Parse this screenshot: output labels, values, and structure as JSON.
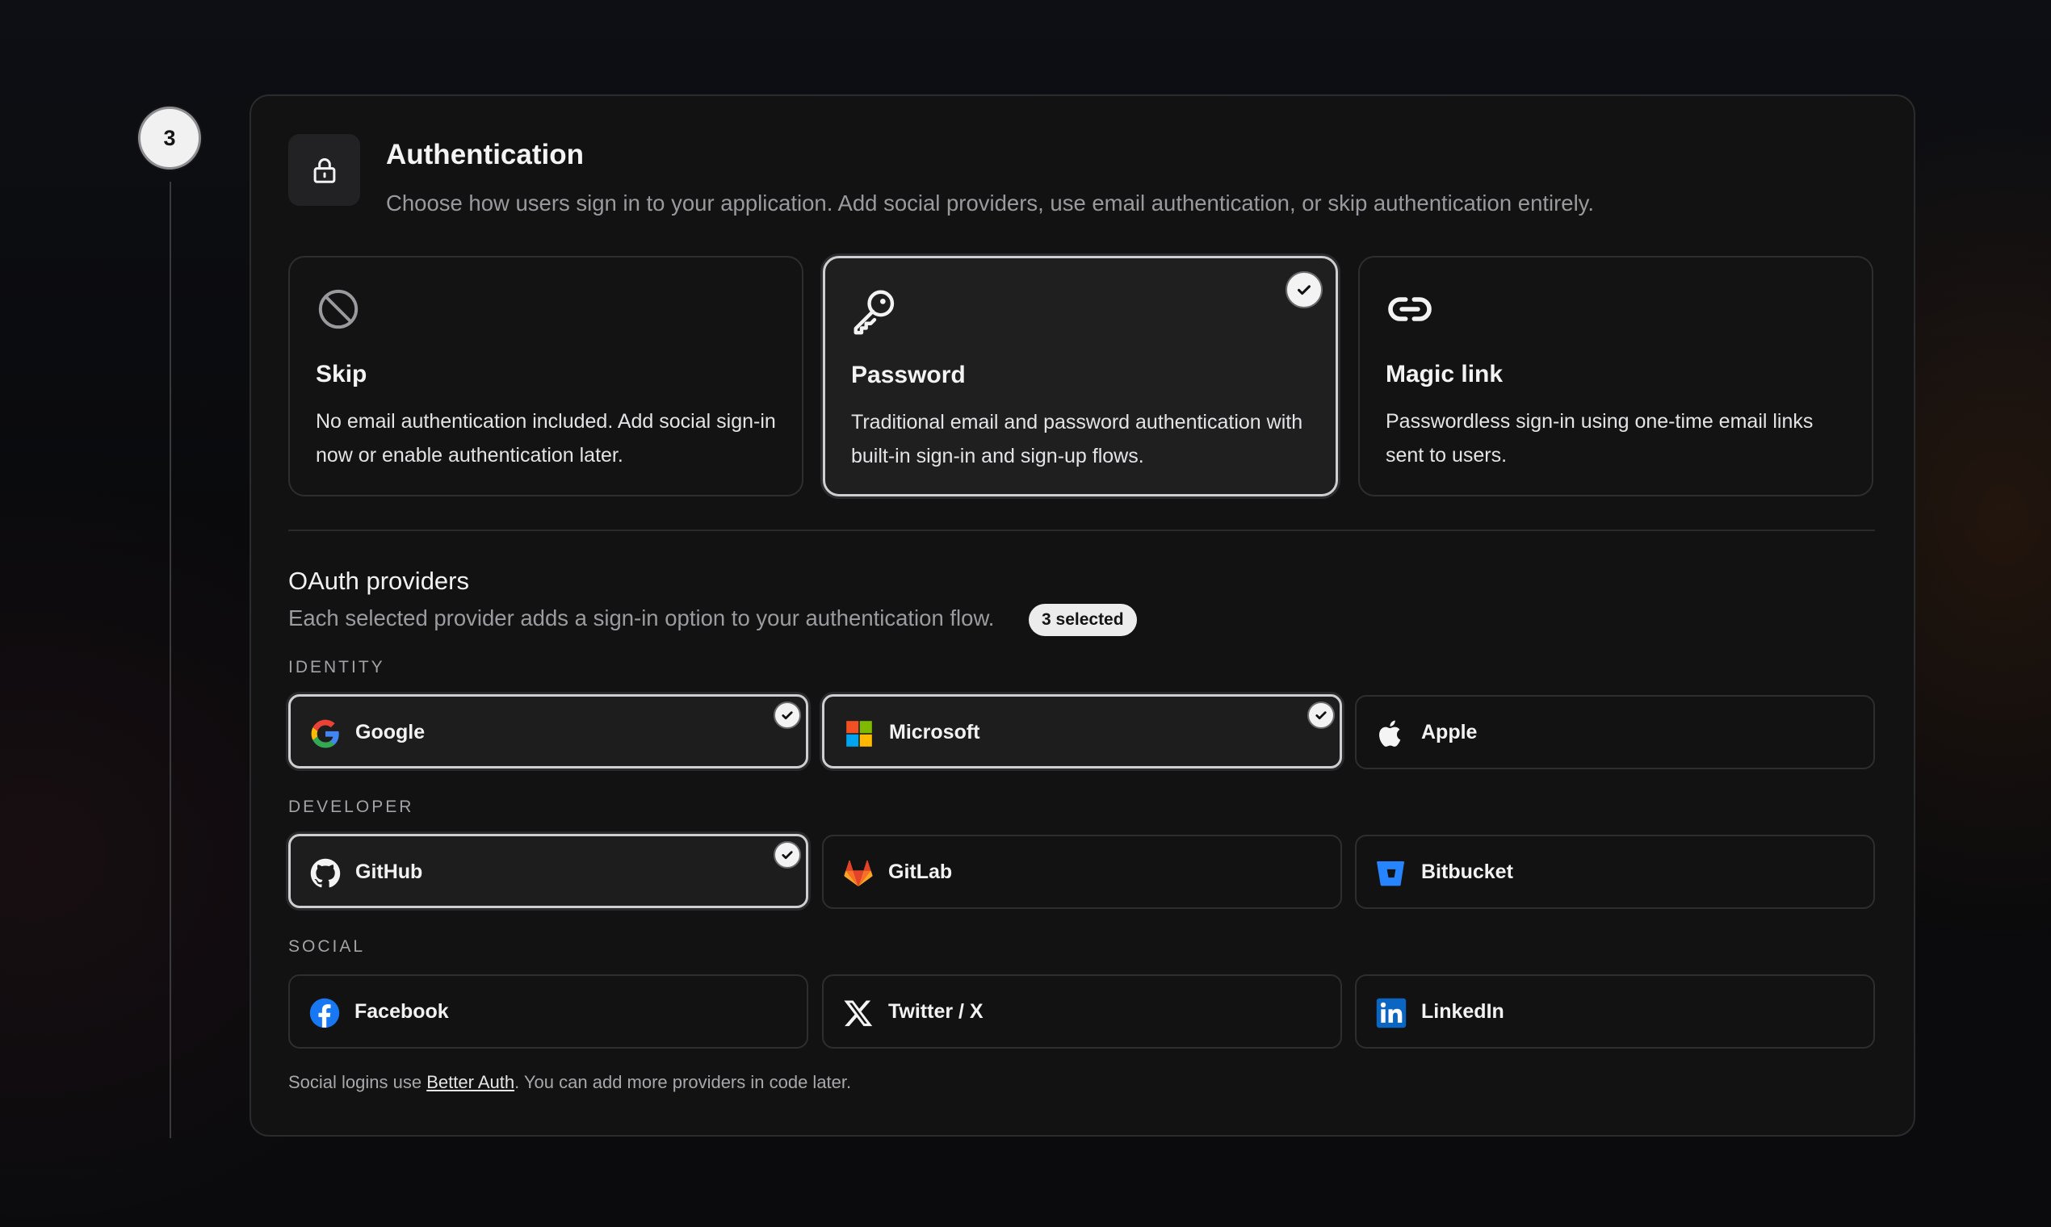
{
  "step": {
    "number": "3"
  },
  "section": {
    "title": "Authentication",
    "description": "Choose how users sign in to your application. Add social providers, use email authentication, or skip authentication entirely."
  },
  "modes": [
    {
      "title": "Skip",
      "description": "No email authentication included. Add social sign-in now or enable authentication later.",
      "icon": "ban-icon",
      "selected": false
    },
    {
      "title": "Password",
      "description": "Traditional email and password authentication with built-in sign-in and sign-up flows.",
      "icon": "key-icon",
      "selected": true
    },
    {
      "title": "Magic link",
      "description": "Passwordless sign-in using one-time email links sent to users.",
      "icon": "link-icon",
      "selected": false
    }
  ],
  "oauth": {
    "title": "OAuth providers",
    "description": "Each selected provider adds a sign-in option to your authentication flow.",
    "badge": "3 selected",
    "groups": [
      {
        "label": "IDENTITY",
        "providers": [
          {
            "name": "Google",
            "icon": "google-icon",
            "selected": true
          },
          {
            "name": "Microsoft",
            "icon": "microsoft-icon",
            "selected": true
          },
          {
            "name": "Apple",
            "icon": "apple-icon",
            "selected": false
          }
        ]
      },
      {
        "label": "DEVELOPER",
        "providers": [
          {
            "name": "GitHub",
            "icon": "github-icon",
            "selected": true
          },
          {
            "name": "GitLab",
            "icon": "gitlab-icon",
            "selected": false
          },
          {
            "name": "Bitbucket",
            "icon": "bitbucket-icon",
            "selected": false
          }
        ]
      },
      {
        "label": "SOCIAL",
        "providers": [
          {
            "name": "Facebook",
            "icon": "facebook-icon",
            "selected": false
          },
          {
            "name": "Twitter / X",
            "icon": "x-icon",
            "selected": false
          },
          {
            "name": "LinkedIn",
            "icon": "linkedin-icon",
            "selected": false
          }
        ]
      }
    ]
  },
  "footer": {
    "prefix": "Social logins use ",
    "link": "Better Auth",
    "suffix": ". You can add more providers in code later."
  },
  "colors": {
    "background": "#0b0b0d",
    "card": "#121212",
    "selected_border": "#cfcfd2",
    "google_blue": "#4285F4",
    "google_red": "#EA4335",
    "google_yellow": "#FBBC05",
    "google_green": "#34A853",
    "microsoft_red": "#F25022",
    "microsoft_green": "#7FBA00",
    "microsoft_blue": "#00A4EF",
    "microsoft_yellow": "#FFB900",
    "gitlab_orange": "#FC6D26",
    "bitbucket_blue": "#2684FF",
    "facebook_blue": "#1877F2",
    "linkedin_blue": "#0A66C2"
  }
}
